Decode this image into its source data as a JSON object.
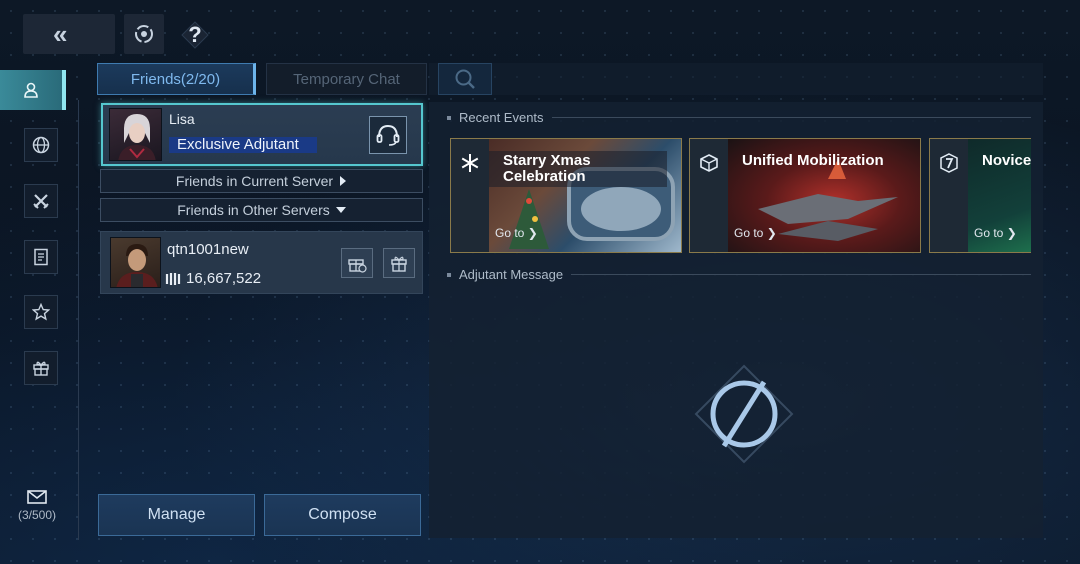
{
  "topbar": {
    "back_glyph": "«",
    "help_glyph": "?"
  },
  "tabs": [
    {
      "label": "Friends(2/20)",
      "active": true
    },
    {
      "label": "Temporary Chat",
      "active": false
    }
  ],
  "nav": {
    "items": [
      {
        "icon": "person-icon",
        "active": true
      },
      {
        "icon": "globe-icon",
        "active": false
      },
      {
        "icon": "crossed-swords-icon",
        "active": false
      },
      {
        "icon": "document-icon",
        "active": false
      },
      {
        "icon": "star-icon",
        "active": false
      },
      {
        "icon": "gift-icon",
        "active": false
      }
    ],
    "mail_count": "(3/500)"
  },
  "adjutant": {
    "name": "Lisa",
    "role": "Exclusive Adjutant"
  },
  "groups": {
    "current_server": "Friends in Current Server",
    "other_servers": "Friends in Other Servers"
  },
  "friends": [
    {
      "name": "qtn1001new",
      "power": "16,667,522"
    }
  ],
  "buttons": {
    "manage": "Manage",
    "compose": "Compose"
  },
  "sections": {
    "recent_events": "Recent Events",
    "adjutant_message": "Adjutant Message"
  },
  "events": [
    {
      "title": "Starry Xmas Celebration",
      "go": "Go to",
      "icon": "snowflake-icon"
    },
    {
      "title": "Unified Mobilization",
      "go": "Go to",
      "icon": "cube-icon"
    },
    {
      "title": "Novice",
      "go": "Go to",
      "icon": "seven-badge-icon"
    }
  ],
  "colors": {
    "accent": "#55c7cf",
    "tab_active": "#7fb9ee",
    "event_border": "#8a7a4a"
  }
}
